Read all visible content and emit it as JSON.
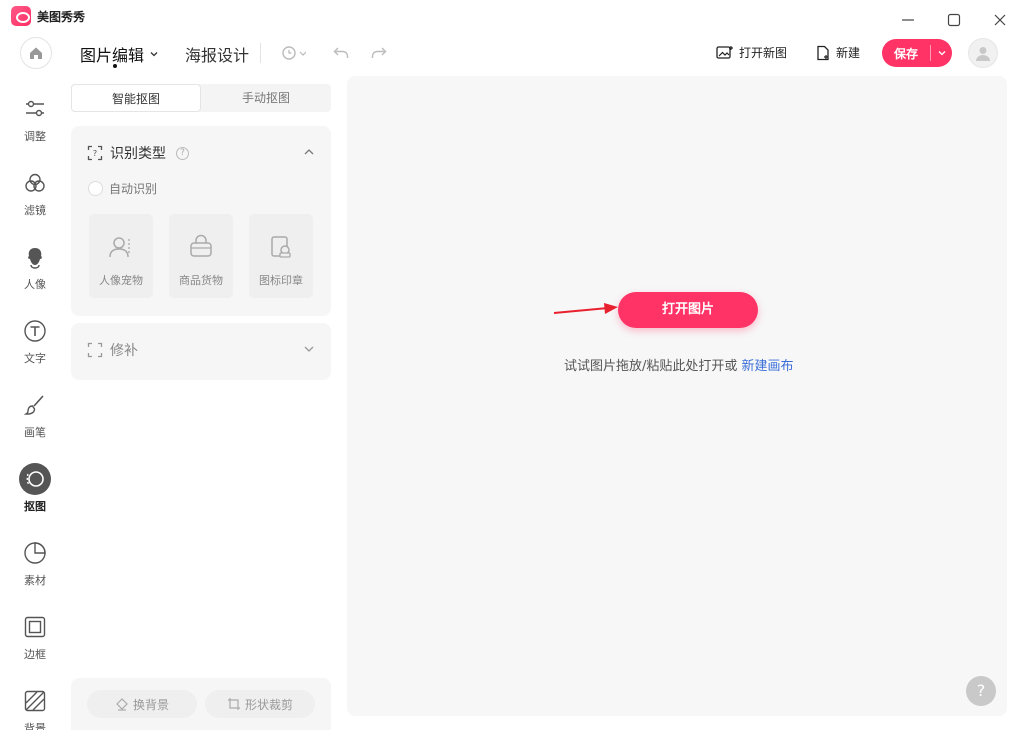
{
  "app": {
    "title": "美图秀秀"
  },
  "toolbar": {
    "tabs": [
      {
        "label": "图片编辑",
        "active": true
      },
      {
        "label": "海报设计",
        "active": false
      }
    ],
    "open_new_label": "打开新图",
    "new_label": "新建",
    "save_label": "保存"
  },
  "rail": {
    "items": [
      {
        "label": "调整",
        "icon": "sliders-icon"
      },
      {
        "label": "滤镜",
        "icon": "filter-icon"
      },
      {
        "label": "人像",
        "icon": "portrait-icon"
      },
      {
        "label": "文字",
        "icon": "text-icon"
      },
      {
        "label": "画笔",
        "icon": "brush-icon"
      },
      {
        "label": "抠图",
        "icon": "cutout-icon",
        "active": true
      },
      {
        "label": "素材",
        "icon": "sticker-icon"
      },
      {
        "label": "边框",
        "icon": "frame-icon"
      },
      {
        "label": "背景",
        "icon": "background-icon"
      }
    ]
  },
  "panel": {
    "segments": [
      "智能抠图",
      "手动抠图"
    ],
    "recognize": {
      "title": "识别类型",
      "auto_label": "自动识别",
      "types": [
        {
          "label": "人像宠物",
          "icon": "person-pet-icon"
        },
        {
          "label": "商品货物",
          "icon": "goods-icon"
        },
        {
          "label": "图标印章",
          "icon": "stamp-icon"
        }
      ]
    },
    "repair": {
      "title": "修补"
    },
    "bottom": {
      "change_bg_label": "换背景",
      "shape_crop_label": "形状裁剪"
    }
  },
  "canvas": {
    "open_button_label": "打开图片",
    "hint_prefix": "试试图片拖放/粘贴此处打开或",
    "hint_link": "新建画布",
    "help_label": "?"
  },
  "colors": {
    "accent": "#ff3366",
    "link": "#3a6fd8"
  }
}
